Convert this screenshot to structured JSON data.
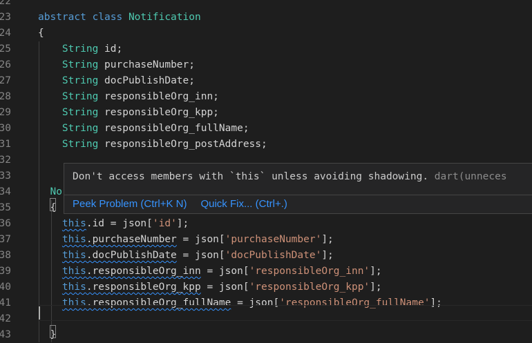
{
  "editor": {
    "lines": [
      {
        "num": "22",
        "segs": []
      },
      {
        "num": "23",
        "segs": [
          {
            "t": "abstract class ",
            "c": "kw"
          },
          {
            "t": "Notification",
            "c": "ty"
          }
        ]
      },
      {
        "num": "24",
        "segs": [
          {
            "t": "{",
            "c": ""
          }
        ]
      },
      {
        "num": "25",
        "segs": [
          {
            "t": "    ",
            "c": ""
          },
          {
            "t": "String",
            "c": "ty"
          },
          {
            "t": " id;",
            "c": ""
          }
        ]
      },
      {
        "num": "26",
        "segs": [
          {
            "t": "    ",
            "c": ""
          },
          {
            "t": "String",
            "c": "ty"
          },
          {
            "t": " purchaseNumber;",
            "c": ""
          }
        ]
      },
      {
        "num": "27",
        "segs": [
          {
            "t": "    ",
            "c": ""
          },
          {
            "t": "String",
            "c": "ty"
          },
          {
            "t": " docPublishDate;",
            "c": ""
          }
        ]
      },
      {
        "num": "28",
        "segs": [
          {
            "t": "    ",
            "c": ""
          },
          {
            "t": "String",
            "c": "ty"
          },
          {
            "t": " responsibleOrg_inn;",
            "c": ""
          }
        ]
      },
      {
        "num": "29",
        "segs": [
          {
            "t": "    ",
            "c": ""
          },
          {
            "t": "String",
            "c": "ty"
          },
          {
            "t": " responsibleOrg_kpp;",
            "c": ""
          }
        ]
      },
      {
        "num": "30",
        "segs": [
          {
            "t": "    ",
            "c": ""
          },
          {
            "t": "String",
            "c": "ty"
          },
          {
            "t": " responsibleOrg_fullName;",
            "c": ""
          }
        ]
      },
      {
        "num": "31",
        "segs": [
          {
            "t": "    ",
            "c": ""
          },
          {
            "t": "String",
            "c": "ty"
          },
          {
            "t": " responsibleOrg_postAddress;",
            "c": ""
          }
        ]
      },
      {
        "num": "32",
        "segs": []
      },
      {
        "num": "33",
        "segs": []
      },
      {
        "num": "34",
        "segs": [
          {
            "t": "  ",
            "c": ""
          },
          {
            "t": "No",
            "c": "ty"
          }
        ]
      },
      {
        "num": "35",
        "segs": [
          {
            "t": "  {",
            "c": ""
          }
        ]
      },
      {
        "num": "36",
        "segs": [
          {
            "t": "    ",
            "c": ""
          },
          {
            "t": "this",
            "c": "kw sq"
          },
          {
            "t": ".id = json[",
            "c": ""
          },
          {
            "t": "'id'",
            "c": "str"
          },
          {
            "t": "];",
            "c": ""
          }
        ]
      },
      {
        "num": "37",
        "segs": [
          {
            "t": "    ",
            "c": ""
          },
          {
            "t": "this.purchaseNumber",
            "c": "kwsq"
          },
          {
            "t": " = json[",
            "c": ""
          },
          {
            "t": "'purchaseNumber'",
            "c": "str"
          },
          {
            "t": "];",
            "c": ""
          }
        ]
      },
      {
        "num": "38",
        "segs": [
          {
            "t": "    ",
            "c": ""
          },
          {
            "t": "this.docPublishDate",
            "c": "kwsq"
          },
          {
            "t": " = json[",
            "c": ""
          },
          {
            "t": "'docPublishDate'",
            "c": "str"
          },
          {
            "t": "];",
            "c": ""
          }
        ]
      },
      {
        "num": "39",
        "segs": [
          {
            "t": "    ",
            "c": ""
          },
          {
            "t": "this.responsibleOrg_inn",
            "c": "kwsq"
          },
          {
            "t": " = json[",
            "c": ""
          },
          {
            "t": "'responsibleOrg_inn'",
            "c": "str"
          },
          {
            "t": "];",
            "c": ""
          }
        ]
      },
      {
        "num": "40",
        "segs": [
          {
            "t": "    ",
            "c": ""
          },
          {
            "t": "this.responsibleOrg_kpp",
            "c": "kwsq"
          },
          {
            "t": " = json[",
            "c": ""
          },
          {
            "t": "'responsibleOrg_kpp'",
            "c": "str"
          },
          {
            "t": "];",
            "c": ""
          }
        ]
      },
      {
        "num": "41",
        "segs": [
          {
            "t": "    ",
            "c": ""
          },
          {
            "t": "this.responsibleOrg_fullName",
            "c": "kwsq"
          },
          {
            "t": " = json[",
            "c": ""
          },
          {
            "t": "'responsibleOrg_fullName'",
            "c": "str"
          },
          {
            "t": "];",
            "c": ""
          }
        ]
      },
      {
        "num": "42",
        "segs": []
      },
      {
        "num": "43",
        "segs": [
          {
            "t": "  }",
            "c": ""
          }
        ]
      }
    ]
  },
  "hover": {
    "message": "Don't access members with `this` unless avoiding shadowing.",
    "source": "dart(unneces",
    "peek_label": "Peek Problem (Ctrl+K N)",
    "quickfix_label": "Quick Fix... (Ctrl+.)"
  }
}
